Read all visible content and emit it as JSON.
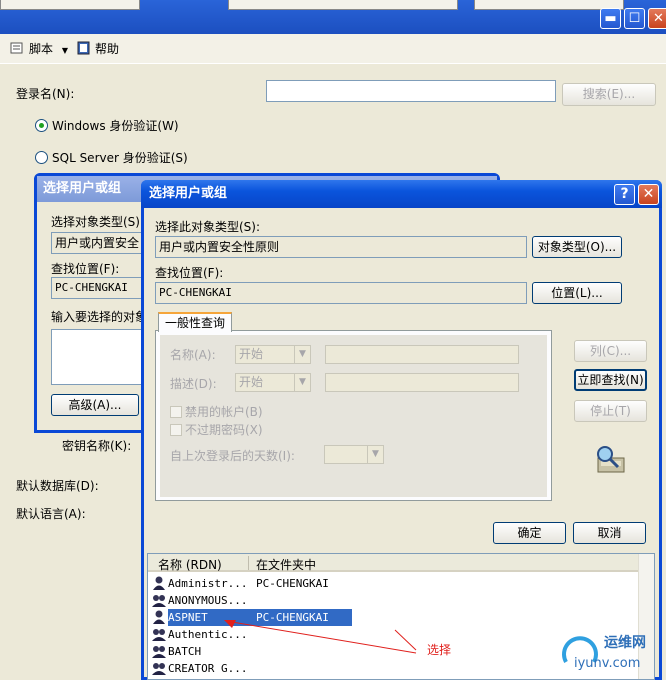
{
  "window": {
    "minimize_glyph": "▬",
    "maximize_glyph": "☐",
    "close_glyph": "✕"
  },
  "toolbar": {
    "script_label": "脚本",
    "help_label": "帮助"
  },
  "login": {
    "login_name_label": "登录名(N):",
    "search_button": "搜索(E)...",
    "windows_auth": "Windows 身份验证(W)",
    "sql_auth": "SQL Server 身份验证(S)",
    "key_name_label": "密钥名称(K):",
    "default_db_label": "默认数据库(D):",
    "default_lang_label": "默认语言(A):"
  },
  "back_dialog": {
    "title": "选择用户或组",
    "object_type_label": "选择对象类型(S)",
    "object_type_value": "用户或内置安全",
    "location_label": "查找位置(F):",
    "location_value": "PC-CHENGKAI",
    "enter_names_label": "输入要选择的对象",
    "advanced_button": "高级(A)..."
  },
  "dialog": {
    "title": "选择用户或组",
    "help_glyph": "?",
    "close_glyph": "✕",
    "object_type_label": "选择此对象类型(S):",
    "object_type_value": "用户或内置安全性原则",
    "object_types_button": "对象类型(O)...",
    "location_label": "查找位置(F):",
    "location_value": "PC-CHENGKAI",
    "locations_button": "位置(L)...",
    "tab_label": "一般性查询",
    "name_label": "名称(A):",
    "name_combo": "开始",
    "desc_label": "描述(D):",
    "desc_combo": "开始",
    "disabled_accounts": "禁用的帐户(B)",
    "non_expiring": "不过期密码(X)",
    "days_since_logon": "自上次登录后的天数(I):",
    "columns_button": "列(C)...",
    "find_now_button": "立即查找(N)",
    "stop_button": "停止(T)",
    "ok_button": "确定",
    "cancel_button": "取消",
    "results": {
      "col_name": "名称 (RDN)",
      "col_folder": "在文件夹中",
      "rows": [
        {
          "name": "Administr...",
          "folder": "PC-CHENGKAI"
        },
        {
          "name": "ANONYMOUS...",
          "folder": ""
        },
        {
          "name": "ASPNET",
          "folder": "PC-CHENGKAI"
        },
        {
          "name": "Authentic...",
          "folder": ""
        },
        {
          "name": "BATCH",
          "folder": ""
        },
        {
          "name": "CREATOR G...",
          "folder": ""
        }
      ]
    }
  },
  "annotation": {
    "text": "选择",
    "color": "#e0201c"
  },
  "watermark": {
    "brand": "运维网",
    "domain": "iyunv.com"
  }
}
